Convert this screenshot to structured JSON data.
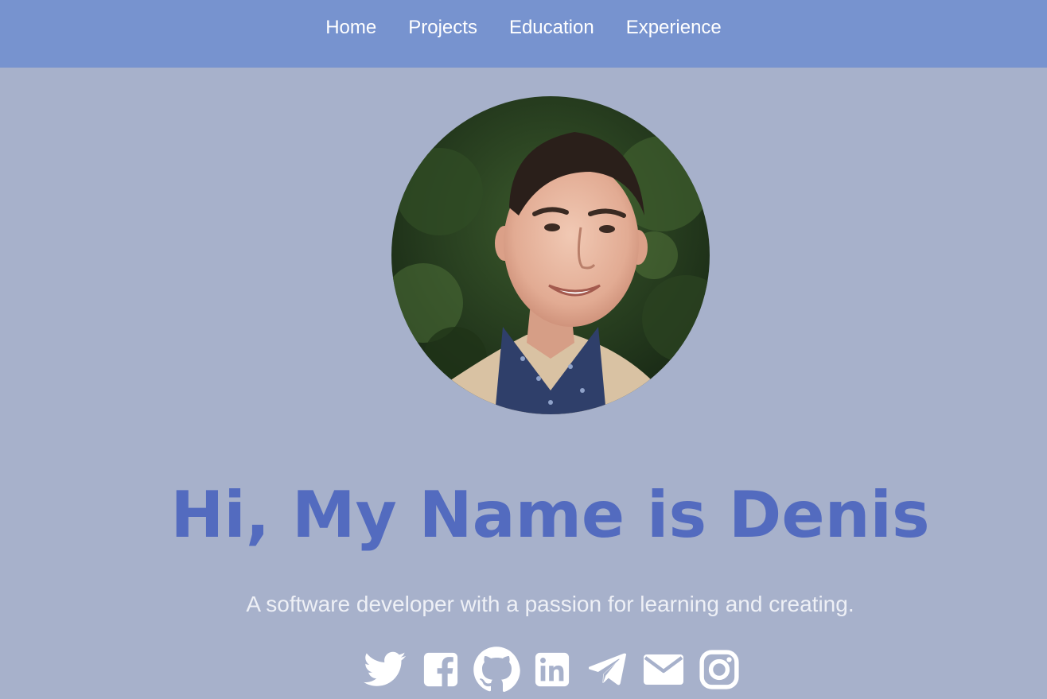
{
  "nav": {
    "items": [
      {
        "label": "Home"
      },
      {
        "label": "Projects"
      },
      {
        "label": "Education"
      },
      {
        "label": "Experience"
      }
    ]
  },
  "hero": {
    "title": "Hi, My Name is Denis",
    "subtitle": "A software developer with a passion for learning and creating."
  },
  "social": {
    "icons": [
      "twitter-icon",
      "facebook-icon",
      "github-icon",
      "linkedin-icon",
      "telegram-icon",
      "email-icon",
      "instagram-icon"
    ]
  },
  "colors": {
    "navbar": "#7793cf",
    "background": "#a7b1cb",
    "title": "#536bbf",
    "subtitle": "#eef0f6",
    "icons": "#ffffff"
  }
}
